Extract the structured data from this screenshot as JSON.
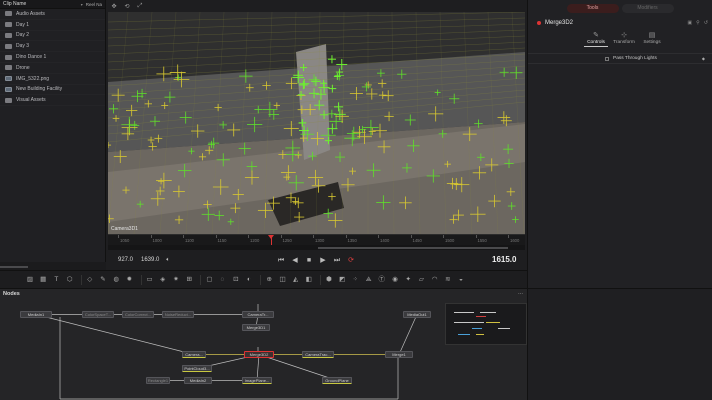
{
  "media_pool": {
    "header": {
      "title": "Clip Name",
      "col2": "Reel Na"
    },
    "items": [
      {
        "label": "Audio Assets",
        "type": "folder"
      },
      {
        "label": "Day 1",
        "type": "folder"
      },
      {
        "label": "Day 2",
        "type": "folder"
      },
      {
        "label": "Day 3",
        "type": "folder"
      },
      {
        "label": "Dino Dance 1",
        "type": "folder"
      },
      {
        "label": "Drone",
        "type": "folder"
      },
      {
        "label": "IMG_5322.png",
        "type": "file"
      },
      {
        "label": "New Building Facility",
        "type": "file"
      },
      {
        "label": "Visual Assets",
        "type": "folder"
      }
    ]
  },
  "viewer": {
    "label": "Camera3D1",
    "ruler_ticks": [
      "1050",
      "1000",
      "1100",
      "1150",
      "1200",
      "1250",
      "1300",
      "1350",
      "1400",
      "1450",
      "1500",
      "1550",
      "1600"
    ],
    "timecode_in": "927.0",
    "timecode_duration": "1639.0",
    "timecode_current": "1615.0"
  },
  "inspector": {
    "tabs": [
      "Tools",
      "Modifiers"
    ],
    "node_name": "Merge3D2",
    "subtabs": [
      "Controls",
      "Transform",
      "Settings"
    ],
    "option_label": "Pass Through Lights"
  },
  "node_editor": {
    "title": "Nodes",
    "menu": "...",
    "nodes": [
      {
        "id": "mediain1",
        "label": "MediaIn1"
      },
      {
        "id": "colorspace",
        "label": "ColorSpaceT..."
      },
      {
        "id": "colorcorr",
        "label": "ColorCorrect..."
      },
      {
        "id": "noisereduce",
        "label": "NoiseReduct..."
      },
      {
        "id": "cameratr1",
        "label": "CameraTr..."
      },
      {
        "id": "merge3d1",
        "label": "Merge3D1"
      },
      {
        "id": "mediaout1",
        "label": "MediaOut1"
      },
      {
        "id": "camera3d",
        "label": "Camera..."
      },
      {
        "id": "merge3d2",
        "label": "Merge3D2"
      },
      {
        "id": "cameratr2",
        "label": "CameraTrac..."
      },
      {
        "id": "merge1",
        "label": "Merge1"
      },
      {
        "id": "pointcloud",
        "label": "PointCloud3..."
      },
      {
        "id": "rectangle",
        "label": "Rectangle1"
      },
      {
        "id": "mediain2",
        "label": "MediaIn2"
      },
      {
        "id": "imageplane",
        "label": "ImagePlane..."
      },
      {
        "id": "groundplane",
        "label": "GroundPlane"
      }
    ]
  },
  "colors": {
    "accent_red": "#dd3333",
    "tracker_green": "#55dd22",
    "tracker_yellow": "#d8c830"
  }
}
